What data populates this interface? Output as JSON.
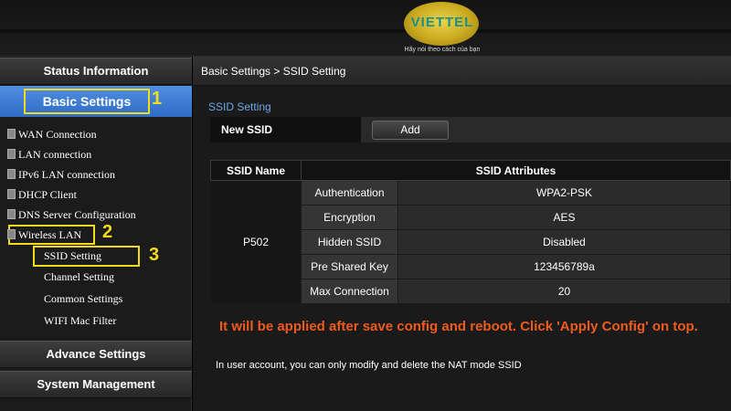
{
  "header": {
    "logo_text": "VIETTEL",
    "slogan": "Hãy nói theo cách của bạn"
  },
  "sidebar": {
    "status_information": "Status Information",
    "basic_settings": "Basic Settings",
    "items": [
      {
        "label": "WAN Connection"
      },
      {
        "label": "LAN connection"
      },
      {
        "label": "IPv6 LAN connection"
      },
      {
        "label": "DHCP Client"
      },
      {
        "label": "DNS Server Configuration"
      },
      {
        "label": "Wireless LAN"
      }
    ],
    "wireless_sub": [
      {
        "label": "SSID Setting"
      },
      {
        "label": "Channel Setting"
      },
      {
        "label": "Common Settings"
      },
      {
        "label": "WIFI Mac Filter"
      }
    ],
    "advance_settings": "Advance Settings",
    "system_management": "System Management"
  },
  "annotations": {
    "n1": "1",
    "n2": "2",
    "n3": "3"
  },
  "main": {
    "breadcrumb": "Basic Settings > SSID Setting",
    "section_title": "SSID Setting",
    "new_ssid_label": "New SSID",
    "add_button": "Add",
    "table": {
      "col_name": "SSID Name",
      "col_attributes": "SSID Attributes",
      "ssid_name": "P502",
      "rows": [
        {
          "attr": "Authentication",
          "value": "WPA2-PSK"
        },
        {
          "attr": "Encryption",
          "value": "AES"
        },
        {
          "attr": "Hidden SSID",
          "value": "Disabled"
        },
        {
          "attr": "Pre Shared Key",
          "value": "123456789a"
        },
        {
          "attr": "Max Connection",
          "value": "20"
        }
      ]
    },
    "warning": "It will be applied after save config and reboot. Click 'Apply Config' on top.",
    "note": "In user account, you can only modify and delete the NAT mode SSID"
  },
  "colors": {
    "accent_blue": "#2f6cc7",
    "highlight_yellow": "#f4dc1c",
    "warning_orange": "#ef5b1d",
    "section_title_blue": "#6fa8e6"
  }
}
